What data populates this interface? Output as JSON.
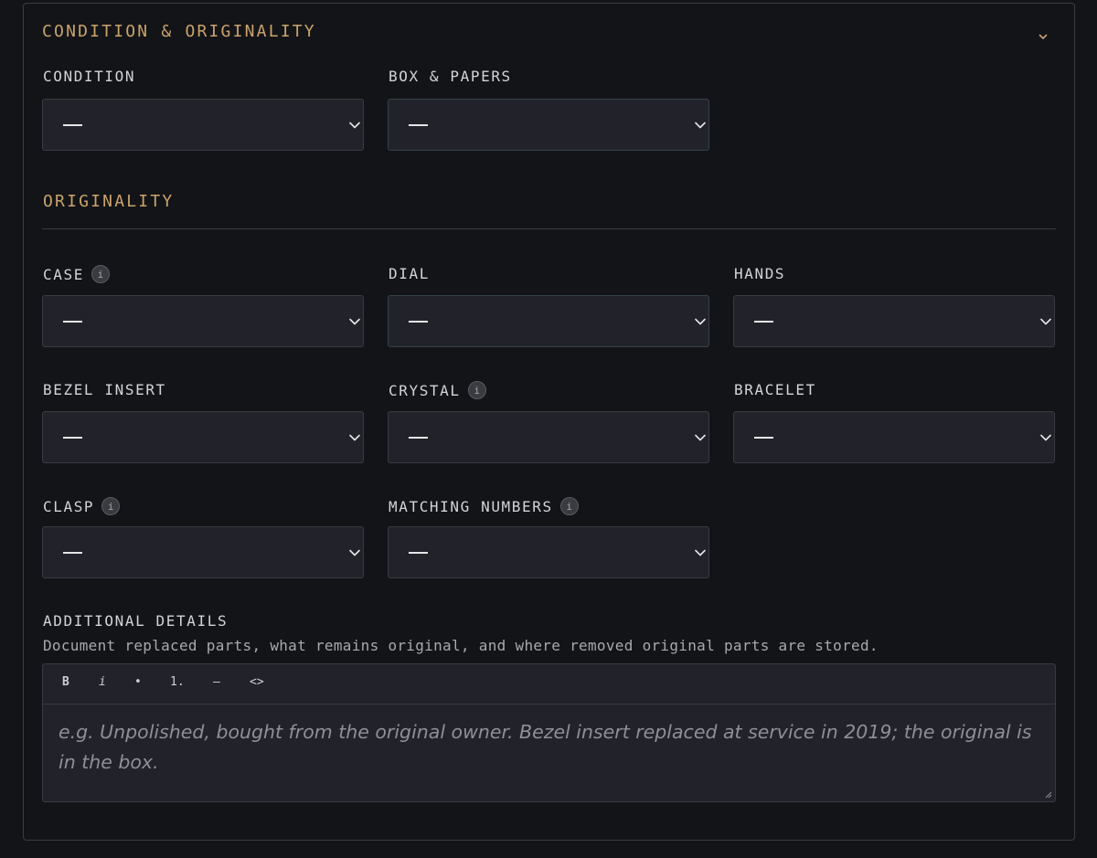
{
  "sections": {
    "condition_title": "CONDITION & ORIGINALITY",
    "originality_title": "ORIGINALITY"
  },
  "fields": {
    "condition": {
      "label": "CONDITION",
      "value": "—"
    },
    "box_papers": {
      "label": "BOX & PAPERS",
      "value": "—"
    },
    "case": {
      "label": "CASE",
      "value": "—"
    },
    "dial": {
      "label": "DIAL",
      "value": "—"
    },
    "hands": {
      "label": "HANDS",
      "value": "—"
    },
    "bezel_insert": {
      "label": "BEZEL INSERT",
      "value": "—"
    },
    "crystal": {
      "label": "CRYSTAL",
      "value": "—"
    },
    "bracelet": {
      "label": "BRACELET",
      "value": "—"
    },
    "clasp": {
      "label": "CLASP",
      "value": "—"
    },
    "matching_numbers": {
      "label": "MATCHING NUMBERS",
      "value": "—"
    }
  },
  "info_icon_glyph": "i",
  "additional_details": {
    "label": "ADDITIONAL DETAILS",
    "helper": "Document replaced parts, what remains original, and where removed original parts are stored.",
    "placeholder": "e.g. Unpolished, bought from the original owner. Bezel insert replaced at service in 2019; the original is in the box.",
    "toolbar": {
      "bold": "B",
      "italic": "i",
      "bullet": "•",
      "numbered": "1.",
      "rule": "—",
      "code": "<>"
    }
  },
  "icons": {
    "collapse": "chevron-down-icon",
    "select": "chevron-down-icon",
    "info": "info-icon",
    "resize": "resize-handle-icon"
  },
  "colors": {
    "background": "#131418",
    "accent": "#c9a36b",
    "field_bg": "#22232a",
    "border": "#393b42"
  }
}
